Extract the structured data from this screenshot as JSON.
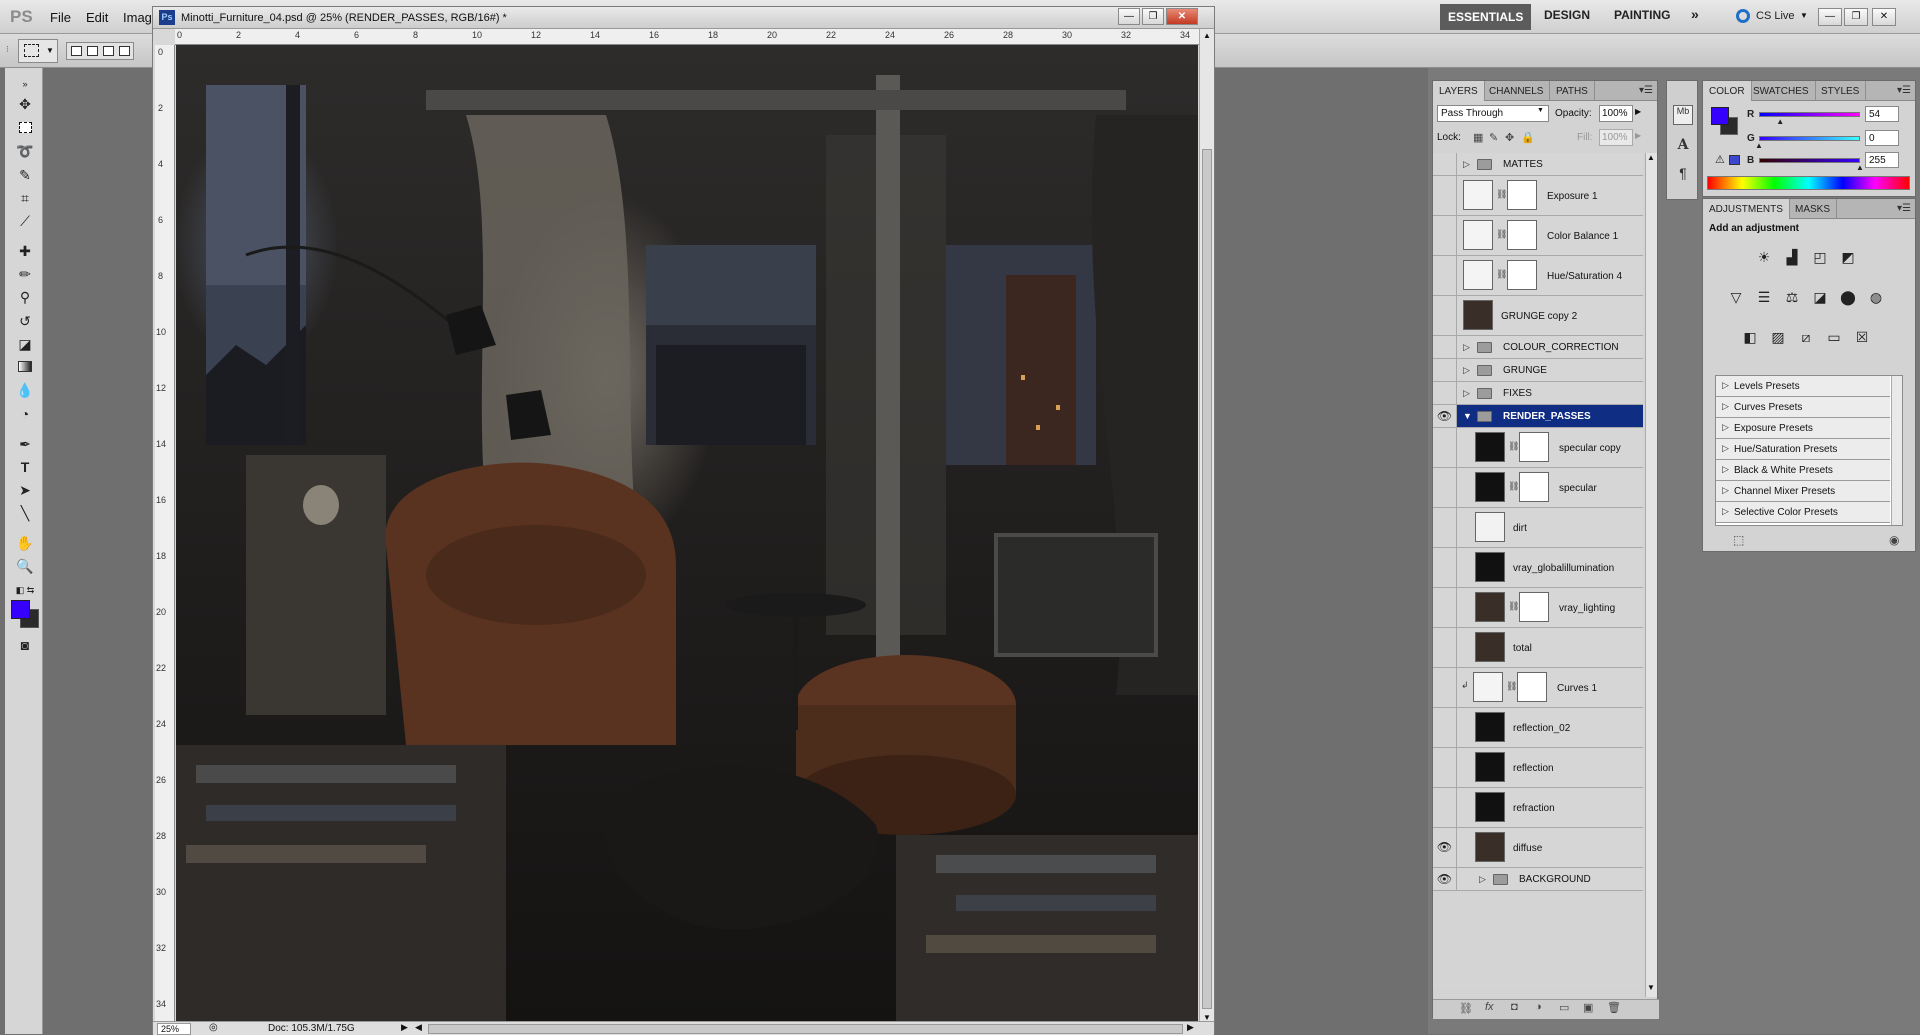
{
  "app": {
    "logo": "PS",
    "menu": [
      "File",
      "Edit",
      "Image"
    ],
    "workspaces": [
      "ESSENTIALS",
      "DESIGN",
      "PAINTING"
    ],
    "more": "»",
    "cslive": "CS Live"
  },
  "document": {
    "ps_badge": "Ps",
    "title": "Minotti_Furniture_04.psd @ 25% (RENDER_PASSES, RGB/16#) *",
    "ruler_top": [
      "0",
      "2",
      "4",
      "6",
      "8",
      "10",
      "12",
      "14",
      "16",
      "18",
      "20",
      "22",
      "24",
      "26",
      "28",
      "30",
      "32",
      "34"
    ],
    "ruler_left": [
      "0",
      "2",
      "4",
      "6",
      "8",
      "10",
      "12",
      "14",
      "16",
      "18",
      "20",
      "22",
      "24",
      "26",
      "28",
      "30",
      "32",
      "34"
    ],
    "zoom": "25%",
    "doc_size": "Doc: 105.3M/1.75G"
  },
  "layers": {
    "tabs": [
      "LAYERS",
      "CHANNELS",
      "PATHS"
    ],
    "blend_mode": "Pass Through",
    "opacity_label": "Opacity:",
    "opacity": "100%",
    "lock_label": "Lock:",
    "fill_label": "Fill:",
    "fill": "100%",
    "rows": [
      {
        "name": "MATTES",
        "kind": "group",
        "visible": false
      },
      {
        "name": "Exposure 1",
        "kind": "adjust",
        "visible": false
      },
      {
        "name": "Color Balance 1",
        "kind": "adjust",
        "visible": false
      },
      {
        "name": "Hue/Saturation 4",
        "kind": "adjust",
        "visible": false
      },
      {
        "name": "GRUNGE copy 2",
        "kind": "pixel",
        "visible": false
      },
      {
        "name": "COLOUR_CORRECTION",
        "kind": "group",
        "visible": false
      },
      {
        "name": "GRUNGE",
        "kind": "group",
        "visible": false
      },
      {
        "name": "FIXES",
        "kind": "group",
        "visible": false
      },
      {
        "name": "RENDER_PASSES",
        "kind": "group-open",
        "visible": true,
        "selected": true
      },
      {
        "name": "specular copy",
        "kind": "pixel-mask",
        "visible": false
      },
      {
        "name": "specular",
        "kind": "pixel-mask",
        "visible": false
      },
      {
        "name": "dirt",
        "kind": "pixel-light",
        "visible": false
      },
      {
        "name": "vray_globalillumination",
        "kind": "pixel",
        "visible": false
      },
      {
        "name": "vray_lighting",
        "kind": "pixel-mask",
        "visible": false
      },
      {
        "name": "total",
        "kind": "pixel",
        "visible": false
      },
      {
        "name": "Curves 1",
        "kind": "adjust-clip",
        "visible": false
      },
      {
        "name": "reflection_02",
        "kind": "pixel",
        "visible": false
      },
      {
        "name": "reflection",
        "kind": "pixel",
        "visible": false
      },
      {
        "name": "refraction",
        "kind": "pixel",
        "visible": false
      },
      {
        "name": "diffuse",
        "kind": "pixel",
        "visible": true
      },
      {
        "name": "BACKGROUND",
        "kind": "group-sub",
        "visible": true
      }
    ]
  },
  "color": {
    "tabs": [
      "COLOR",
      "SWATCHES",
      "STYLES"
    ],
    "r": "54",
    "g": "0",
    "b": "255",
    "foreground": "#3600ff",
    "r_frac": 0.21,
    "g_frac": 0.0,
    "b_frac": 1.0
  },
  "adjustments": {
    "tabs": [
      "ADJUSTMENTS",
      "MASKS"
    ],
    "heading": "Add an adjustment",
    "presets": [
      "Levels Presets",
      "Curves Presets",
      "Exposure Presets",
      "Hue/Saturation Presets",
      "Black & White Presets",
      "Channel Mixer Presets",
      "Selective Color Presets"
    ]
  }
}
